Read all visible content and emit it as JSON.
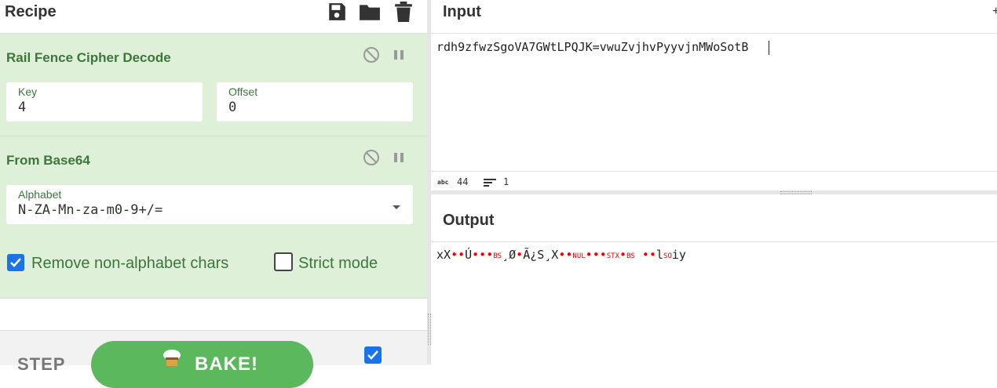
{
  "recipe": {
    "title": "Recipe",
    "icons": [
      "save-icon",
      "folder-icon",
      "trash-icon"
    ]
  },
  "operations": [
    {
      "title": "Rail Fence Cipher Decode",
      "fields": [
        {
          "label": "Key",
          "value": "4"
        },
        {
          "label": "Offset",
          "value": "0"
        }
      ]
    },
    {
      "title": "From Base64",
      "alphabet": {
        "label": "Alphabet",
        "value": "N-ZA-Mn-za-m0-9+/="
      },
      "remove_non_alphabet": {
        "label": "Remove non-alphabet chars",
        "checked": true
      },
      "strict_mode": {
        "label": "Strict mode",
        "checked": false
      }
    }
  ],
  "controls": {
    "step_label": "STEP",
    "bake_label": "BAKE!",
    "auto_bake_checked": true
  },
  "input": {
    "title": "Input",
    "text": "rdh9zfwzSgoVA7GWtLPQJK=vwuZvjhvPyyvjnMWoSotB",
    "length_icon": "abc",
    "length": "44",
    "lines": "1"
  },
  "output": {
    "title": "Output",
    "segments": [
      {
        "t": "xX"
      },
      {
        "d": "••"
      },
      {
        "t": "Ú"
      },
      {
        "d": "•••"
      },
      {
        "c": "BS"
      },
      {
        "t": "¸Ø"
      },
      {
        "d": "•"
      },
      {
        "t": "Ã¿S¸X"
      },
      {
        "d": "••"
      },
      {
        "c": "NUL"
      },
      {
        "d": "•••"
      },
      {
        "c": "STX"
      },
      {
        "d": "•"
      },
      {
        "c": "BS"
      },
      {
        "d": " ••"
      },
      {
        "t": "l"
      },
      {
        "c": "SO"
      },
      {
        "t": "iy"
      }
    ]
  },
  "colors": {
    "accent_green": "#3c763d",
    "op_bg": "#dff0d8",
    "bake_green": "#5cb85c",
    "checkbox_blue": "#1a73e8",
    "control_char_red": "#ee0000"
  }
}
